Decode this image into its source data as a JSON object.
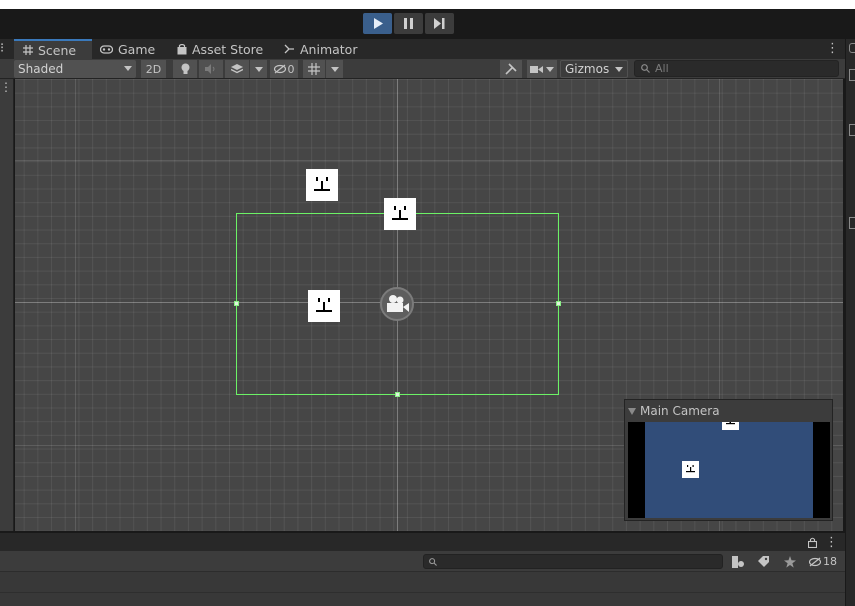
{
  "play_controls": {
    "play_icon": "play-icon",
    "pause_icon": "pause-icon",
    "step_icon": "step-icon"
  },
  "tabs": [
    {
      "label": "Scene",
      "icon": "grid-icon",
      "selected": true
    },
    {
      "label": "Game",
      "icon": "gamepad-icon",
      "selected": false
    },
    {
      "label": "Asset Store",
      "icon": "shopping-bag-icon",
      "selected": false
    },
    {
      "label": "Animator",
      "icon": "animator-icon",
      "selected": false
    }
  ],
  "scene_toolbar": {
    "draw_mode": "Shaded",
    "mode_2d": "2D",
    "hidden_count": "0",
    "gizmos": "Gizmos",
    "search_placeholder": "All"
  },
  "camera_preview": {
    "title": "Main Camera"
  },
  "bottom_panel": {
    "hidden_count": "18"
  },
  "colors": {
    "accent": "#3a79bb",
    "play_active": "#3a5f8c",
    "camera_bounds": "#6cf266",
    "camera_background": "#314d79",
    "scene_background": "#464646"
  }
}
